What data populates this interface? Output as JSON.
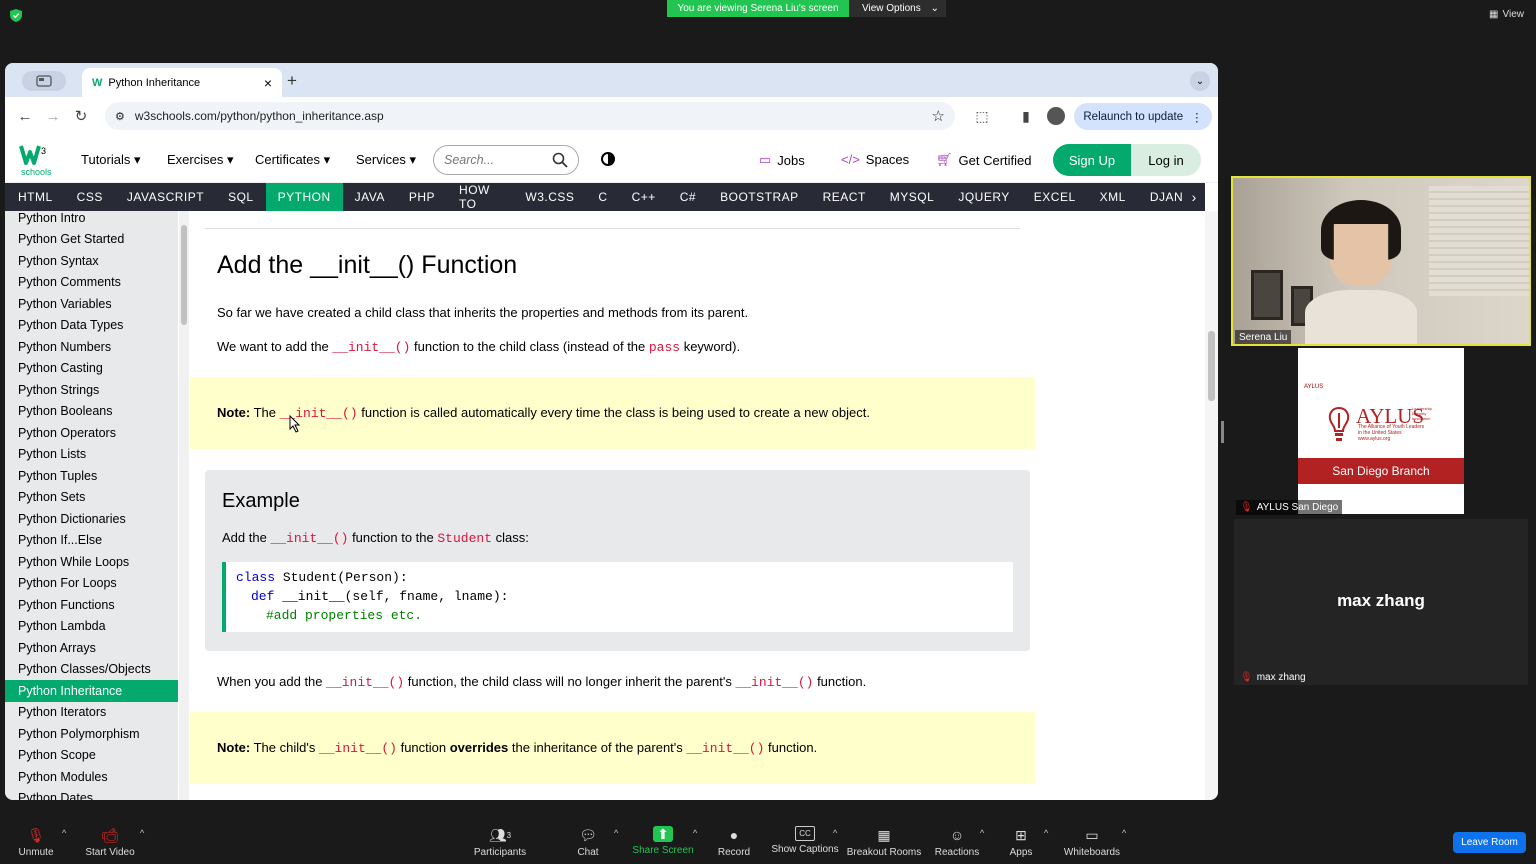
{
  "zoom": {
    "banner": "You are viewing Serena Liu's screen",
    "view_options": "View Options",
    "view": "View",
    "leave": "Leave Room",
    "participants_count": "3",
    "toolbar": [
      {
        "label": "Unmute",
        "icon": "mic-muted-icon"
      },
      {
        "label": "Start Video",
        "icon": "video-off-icon"
      },
      {
        "label": "Participants",
        "icon": "participants-icon"
      },
      {
        "label": "Chat",
        "icon": "chat-icon"
      },
      {
        "label": "Share Screen",
        "icon": "share-screen-icon"
      },
      {
        "label": "Record",
        "icon": "record-icon"
      },
      {
        "label": "Show Captions",
        "icon": "captions-icon"
      },
      {
        "label": "Breakout Rooms",
        "icon": "breakout-icon"
      },
      {
        "label": "Reactions",
        "icon": "reactions-icon"
      },
      {
        "label": "Apps",
        "icon": "apps-icon"
      },
      {
        "label": "Whiteboards",
        "icon": "whiteboard-icon"
      }
    ],
    "tiles": [
      {
        "name": "Serena Liu"
      },
      {
        "name": "AYLUS San Diego",
        "org_title": "AYLUS",
        "org_small": "AYLUS",
        "org_tagline1": "Leadership",
        "org_tagline2": "Integrity",
        "org_tagline3": "Innovation",
        "org_sub1": "The Alliance of Youth Leaders",
        "org_sub2": "in the United States",
        "org_url": "www.aylus.org",
        "branch": "San Diego Branch"
      },
      {
        "name": "max zhang"
      }
    ],
    "colors": {
      "share_green": "#23c552",
      "leave_blue": "#0e72ed",
      "active_speaker": "#e4e33b"
    }
  },
  "browser": {
    "tab_title": "Python Inheritance",
    "url": "w3schools.com/python/python_inheritance.asp",
    "relaunch": "Relaunch to update"
  },
  "w3": {
    "logo_text": "schools",
    "logo_super": "3",
    "menu": [
      "Tutorials",
      "Exercises",
      "Certificates",
      "Services"
    ],
    "search_placeholder": "Search...",
    "jobs": "Jobs",
    "spaces": "Spaces",
    "certified": "Get Certified",
    "signup": "Sign Up",
    "login": "Log in",
    "topnav": [
      "HTML",
      "CSS",
      "JAVASCRIPT",
      "SQL",
      "PYTHON",
      "JAVA",
      "PHP",
      "HOW TO",
      "W3.CSS",
      "C",
      "C++",
      "C#",
      "BOOTSTRAP",
      "REACT",
      "MYSQL",
      "JQUERY",
      "EXCEL",
      "XML",
      "DJANG"
    ],
    "active_nav": "PYTHON",
    "sidebar": [
      "Python Intro",
      "Python Get Started",
      "Python Syntax",
      "Python Comments",
      "Python Variables",
      "Python Data Types",
      "Python Numbers",
      "Python Casting",
      "Python Strings",
      "Python Booleans",
      "Python Operators",
      "Python Lists",
      "Python Tuples",
      "Python Sets",
      "Python Dictionaries",
      "Python If...Else",
      "Python While Loops",
      "Python For Loops",
      "Python Functions",
      "Python Lambda",
      "Python Arrays",
      "Python Classes/Objects",
      "Python Inheritance",
      "Python Iterators",
      "Python Polymorphism",
      "Python Scope",
      "Python Modules",
      "Python Dates"
    ],
    "active_sidebar": "Python Inheritance",
    "colors": {
      "green": "#04aa6d",
      "nav_dark": "#282a35",
      "note_yellow": "#ffffcc",
      "code_red": "#dc143c"
    }
  },
  "content": {
    "heading": "Add the __init__() Function",
    "p1": "So far we have created a child class that inherits the properties and methods from its parent.",
    "p2_a": "We want to add the ",
    "p2_code1": "__init__()",
    "p2_b": " function to the child class (instead of the ",
    "p2_code2": "pass",
    "p2_c": " keyword).",
    "note1_label": "Note:",
    "note1_a": " The ",
    "note1_code": "__init__()",
    "note1_b": " function is called automatically every time the class is being used to create a new object.",
    "example_title": "Example",
    "ex_a": "Add the ",
    "ex_code1": "__init__()",
    "ex_b": " function to the ",
    "ex_code2": "Student",
    "ex_c": " class:",
    "code_l1_kw": "class",
    "code_l1": " Student(Person):",
    "code_l2_kw": "def",
    "code_l2": " __init__(self, fname, lname):",
    "code_l3": "#add properties etc.",
    "p3_a": "When you add the ",
    "p3_code1": "__init__()",
    "p3_b": " function, the child class will no longer inherit the parent's ",
    "p3_code2": "__init__()",
    "p3_c": " function.",
    "note2_label": "Note:",
    "note2_a": " The child's ",
    "note2_code1": "__init__()",
    "note2_b": " function ",
    "note2_bold": "overrides",
    "note2_c": " the inheritance of the parent's ",
    "note2_code2": "__init__()",
    "note2_d": " function."
  }
}
